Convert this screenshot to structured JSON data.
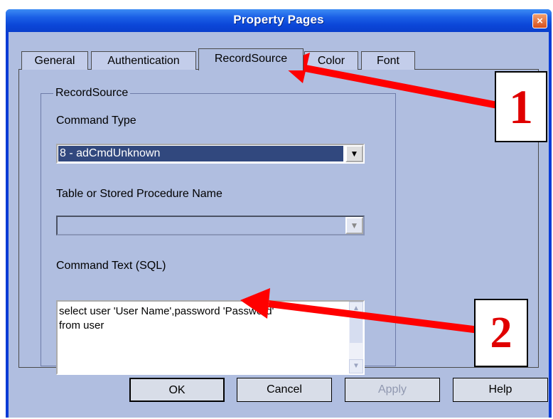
{
  "window": {
    "title": "Property Pages",
    "close_label": "×"
  },
  "tabs": [
    {
      "label": "General"
    },
    {
      "label": "Authentication"
    },
    {
      "label": "RecordSource",
      "active": true
    },
    {
      "label": "Color"
    },
    {
      "label": "Font"
    }
  ],
  "recordsource": {
    "group_label": "RecordSource",
    "command_type_label": "Command Type",
    "command_type_value": "8 - adCmdUnknown",
    "table_label": "Table or Stored Procedure Name",
    "table_value": "",
    "command_text_label": "Command Text (SQL)",
    "command_text_value": "select user 'User Name',password 'Password'\nfrom user"
  },
  "buttons": {
    "ok": "OK",
    "cancel": "Cancel",
    "apply": "Apply",
    "help": "Help"
  },
  "annotations": {
    "one": "1",
    "two": "2",
    "arrow_color": "#ff0000"
  },
  "icons": {
    "dropdown": "▼",
    "scroll_up": "▲",
    "scroll_down": "▼"
  }
}
